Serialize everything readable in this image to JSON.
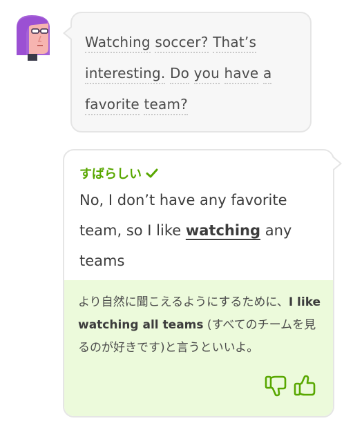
{
  "question": {
    "lines": [
      [
        "Watching",
        "soccer?",
        "That’s"
      ],
      [
        "interesting.",
        "Do",
        "you",
        "have",
        "a"
      ],
      [
        "favorite",
        "team?"
      ]
    ]
  },
  "answer": {
    "verdict": "すばらしい",
    "text_before": "No, I don’t have any favorite team, so I like ",
    "highlight": "watching",
    "text_after": " any teams"
  },
  "feedback": {
    "part1": "より自然に聞こえるようにするために、",
    "suggestion": "I like watching all teams",
    "part2": " (すべてのチームを見るのが好きです)と言うといいよ。"
  },
  "colors": {
    "correct_green": "#58a700",
    "feedback_bg": "#ecfadb",
    "bubble_border": "#e5e5e5",
    "avatar_hair": "#9b59d0",
    "avatar_skin": "#f5b7b1"
  },
  "icons": {
    "avatar": "user-avatar",
    "verdict": "check-icon",
    "dislike": "thumbs-down-icon",
    "like": "thumbs-up-icon"
  }
}
